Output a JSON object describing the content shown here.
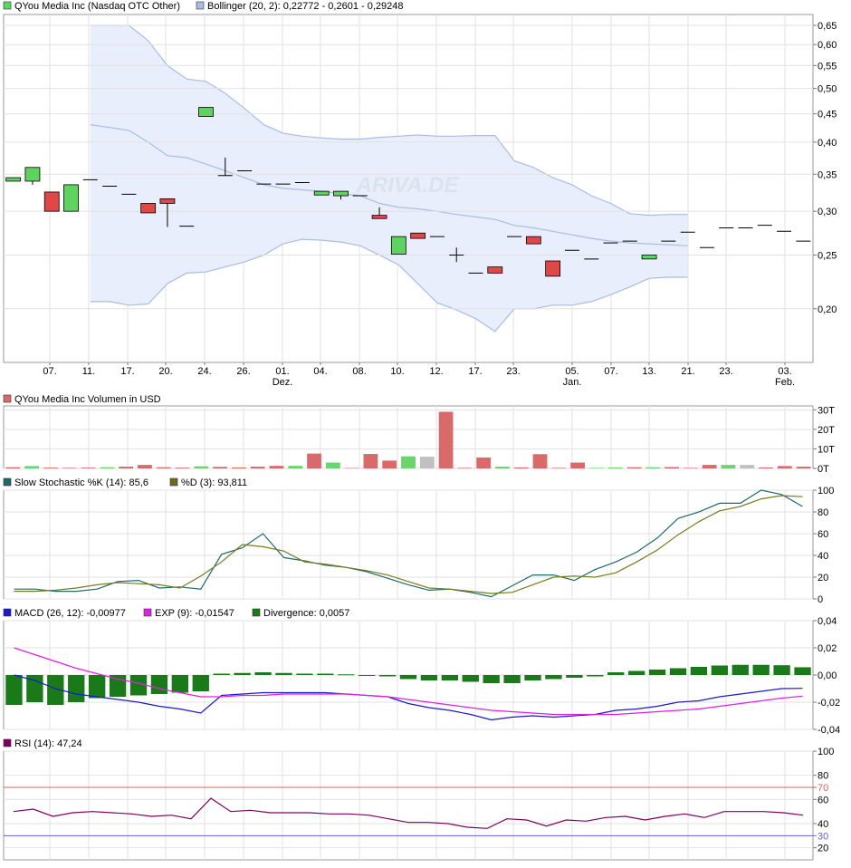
{
  "legends": {
    "price": {
      "label": "QYou Media Inc (Nasdaq OTC Other)",
      "color": "#5fd35f"
    },
    "bollinger": {
      "label": "Bollinger (20, 2): 0,22772 - 0,2601 - 0,29248",
      "color": "#a9bde3"
    },
    "volume": {
      "label": "QYou Media Inc Volumen in USD",
      "color": "#d86a6a"
    },
    "stoch_k": {
      "label": "Slow Stochastic %K (14): 85,6",
      "color": "#1f6b6b"
    },
    "stoch_d": {
      "label": "%D (3): 93,811",
      "color": "#6b6b1f"
    },
    "macd": {
      "label": "MACD (26, 12): -0,00977",
      "color": "#1a1acc"
    },
    "exp": {
      "label": "EXP (9): -0,01547",
      "color": "#e020e0"
    },
    "divergence": {
      "label": "Divergence: 0,0057",
      "color": "#1a7a1a"
    },
    "rsi": {
      "label": "RSI (14): 47,24",
      "color": "#800060"
    }
  },
  "watermark": "ARIVA.DE",
  "chart_data": [
    {
      "type": "candlestick",
      "name": "price",
      "x_ticks": [
        "07.",
        "11.",
        "17.",
        "20.",
        "24.",
        "26.",
        "01.",
        "04.",
        "08.",
        "10.",
        "12.",
        "17.",
        "23.",
        "05.",
        "07.",
        "13.",
        "21.",
        "23.",
        "03."
      ],
      "x_month_labels": [
        {
          "tick": "01.",
          "label": "Dez."
        },
        {
          "tick": "05.",
          "label": "Jan."
        },
        {
          "tick": "03.",
          "label": "Feb."
        }
      ],
      "y_ticks": [
        "0,65",
        "0,60",
        "0,55",
        "0,50",
        "0,45",
        "0,40",
        "0,35",
        "0,30",
        "0,25",
        "0,20"
      ],
      "y_scale": "log",
      "ylim": [
        0.16,
        0.68
      ],
      "candles": [
        {
          "o": 0.34,
          "h": 0.345,
          "l": 0.34,
          "c": 0.345
        },
        {
          "o": 0.34,
          "h": 0.36,
          "l": 0.335,
          "c": 0.36
        },
        {
          "o": 0.325,
          "h": 0.325,
          "l": 0.3,
          "c": 0.3
        },
        {
          "o": 0.3,
          "h": 0.335,
          "l": 0.3,
          "c": 0.335
        },
        {
          "o": 0.342,
          "h": 0.342,
          "l": 0.342,
          "c": 0.342
        },
        {
          "o": 0.333,
          "h": 0.333,
          "l": 0.333,
          "c": 0.333
        },
        {
          "o": 0.322,
          "h": 0.322,
          "l": 0.322,
          "c": 0.322
        },
        {
          "o": 0.31,
          "h": 0.31,
          "l": 0.298,
          "c": 0.298
        },
        {
          "o": 0.316,
          "h": 0.316,
          "l": 0.281,
          "c": 0.31
        },
        {
          "o": 0.282,
          "h": 0.282,
          "l": 0.282,
          "c": 0.282
        },
        {
          "o": 0.445,
          "h": 0.462,
          "l": 0.445,
          "c": 0.462
        },
        {
          "o": 0.348,
          "h": 0.375,
          "l": 0.348,
          "c": 0.348
        },
        {
          "o": 0.355,
          "h": 0.355,
          "l": 0.355,
          "c": 0.355
        },
        {
          "o": 0.336,
          "h": 0.336,
          "l": 0.336,
          "c": 0.336
        },
        {
          "o": 0.336,
          "h": 0.336,
          "l": 0.336,
          "c": 0.336
        },
        {
          "o": 0.338,
          "h": 0.338,
          "l": 0.338,
          "c": 0.338
        },
        {
          "o": 0.321,
          "h": 0.326,
          "l": 0.321,
          "c": 0.326
        },
        {
          "o": 0.32,
          "h": 0.326,
          "l": 0.315,
          "c": 0.326
        },
        {
          "o": 0.32,
          "h": 0.32,
          "l": 0.32,
          "c": 0.32
        },
        {
          "o": 0.295,
          "h": 0.305,
          "l": 0.291,
          "c": 0.291
        },
        {
          "o": 0.251,
          "h": 0.27,
          "l": 0.251,
          "c": 0.27
        },
        {
          "o": 0.274,
          "h": 0.274,
          "l": 0.268,
          "c": 0.268
        },
        {
          "o": 0.27,
          "h": 0.27,
          "l": 0.27,
          "c": 0.27
        },
        {
          "o": 0.25,
          "h": 0.258,
          "l": 0.243,
          "c": 0.25
        },
        {
          "o": 0.232,
          "h": 0.232,
          "l": 0.232,
          "c": 0.232
        },
        {
          "o": 0.238,
          "h": 0.238,
          "l": 0.232,
          "c": 0.232
        },
        {
          "o": 0.27,
          "h": 0.27,
          "l": 0.27,
          "c": 0.27
        },
        {
          "o": 0.27,
          "h": 0.27,
          "l": 0.262,
          "c": 0.262
        },
        {
          "o": 0.244,
          "h": 0.244,
          "l": 0.229,
          "c": 0.229
        },
        {
          "o": 0.255,
          "h": 0.255,
          "l": 0.255,
          "c": 0.255
        },
        {
          "o": 0.246,
          "h": 0.246,
          "l": 0.246,
          "c": 0.246
        },
        {
          "o": 0.263,
          "h": 0.263,
          "l": 0.263,
          "c": 0.263
        },
        {
          "o": 0.265,
          "h": 0.265,
          "l": 0.265,
          "c": 0.265
        },
        {
          "o": 0.246,
          "h": 0.25,
          "l": 0.246,
          "c": 0.25
        },
        {
          "o": 0.265,
          "h": 0.265,
          "l": 0.265,
          "c": 0.265
        },
        {
          "o": 0.275,
          "h": 0.275,
          "l": 0.275,
          "c": 0.275
        },
        {
          "o": 0.258,
          "h": 0.258,
          "l": 0.258,
          "c": 0.258
        },
        {
          "o": 0.28,
          "h": 0.28,
          "l": 0.28,
          "c": 0.28
        },
        {
          "o": 0.28,
          "h": 0.28,
          "l": 0.28,
          "c": 0.28
        },
        {
          "o": 0.283,
          "h": 0.283,
          "l": 0.283,
          "c": 0.283
        },
        {
          "o": 0.276,
          "h": 0.276,
          "l": 0.276,
          "c": 0.276
        },
        {
          "o": 0.265,
          "h": 0.265,
          "l": 0.265,
          "c": 0.265
        }
      ],
      "bollinger": {
        "start_index": 4,
        "upper": [
          0.65,
          0.65,
          0.65,
          0.61,
          0.55,
          0.52,
          0.515,
          0.49,
          0.46,
          0.43,
          0.415,
          0.41,
          0.407,
          0.405,
          0.405,
          0.408,
          0.41,
          0.412,
          0.41,
          0.41,
          0.411,
          0.411,
          0.37,
          0.36,
          0.345,
          0.335,
          0.32,
          0.31,
          0.297,
          0.295,
          0.296,
          0.296
        ],
        "middle": [
          0.43,
          0.425,
          0.42,
          0.4,
          0.378,
          0.375,
          0.365,
          0.355,
          0.345,
          0.335,
          0.33,
          0.328,
          0.326,
          0.323,
          0.32,
          0.31,
          0.305,
          0.303,
          0.3,
          0.296,
          0.293,
          0.29,
          0.283,
          0.28,
          0.276,
          0.272,
          0.268,
          0.265,
          0.263,
          0.262,
          0.261,
          0.26
        ],
        "lower": [
          0.206,
          0.206,
          0.203,
          0.204,
          0.222,
          0.232,
          0.233,
          0.238,
          0.243,
          0.25,
          0.262,
          0.267,
          0.266,
          0.264,
          0.26,
          0.25,
          0.24,
          0.222,
          0.205,
          0.199,
          0.192,
          0.182,
          0.2,
          0.2,
          0.203,
          0.203,
          0.206,
          0.212,
          0.219,
          0.227,
          0.228,
          0.228
        ]
      }
    },
    {
      "type": "bar",
      "name": "volume",
      "y_ticks": [
        "30T",
        "20T",
        "10T",
        "0T"
      ],
      "ylim": [
        0,
        32
      ],
      "values": [
        0.6,
        1.2,
        0.4,
        0.3,
        0.4,
        0.6,
        0.9,
        1.8,
        0.6,
        0.4,
        1.1,
        0.8,
        0.5,
        0.9,
        1.3,
        1.3,
        7.6,
        3.0,
        0.2,
        7.4,
        4.0,
        6.2,
        6.0,
        29.0,
        0.3,
        5.6,
        0.9,
        0.5,
        7.3,
        0.3,
        3.0,
        0.3,
        0.5,
        0.6,
        0.6,
        0.7,
        0.3,
        1.8,
        1.8,
        1.8,
        0.5,
        1.2,
        0.9
      ],
      "colors": [
        "red",
        "green",
        "red",
        "red",
        "red",
        "green",
        "red",
        "red",
        "red",
        "red",
        "green",
        "red",
        "red",
        "red",
        "red",
        "green",
        "red",
        "green",
        "red",
        "red",
        "red",
        "green",
        "grey",
        "red",
        "red",
        "red",
        "green",
        "red",
        "red",
        "red",
        "red",
        "green",
        "green",
        "red",
        "green",
        "red",
        "red",
        "red",
        "green",
        "grey",
        "red",
        "red",
        "red"
      ]
    },
    {
      "type": "line",
      "name": "slow_stochastic",
      "y_ticks": [
        "100",
        "80",
        "60",
        "40",
        "20",
        "0"
      ],
      "ylim": [
        0,
        100
      ],
      "series": [
        {
          "name": "%K",
          "values": [
            9,
            9,
            7,
            7,
            9,
            16,
            17,
            10,
            11,
            9,
            41,
            47,
            60,
            38,
            35,
            31,
            29,
            25,
            19,
            13,
            8,
            9,
            6,
            2,
            12,
            22,
            22,
            17,
            27,
            34,
            43,
            56,
            74,
            80,
            88,
            88,
            100,
            96,
            85
          ]
        },
        {
          "name": "%D",
          "values": [
            7,
            7,
            8,
            10,
            13,
            15,
            14,
            13,
            10,
            21,
            34,
            50,
            48,
            44,
            34,
            32,
            29,
            26,
            22,
            16,
            10,
            9,
            7,
            5,
            6,
            13,
            20,
            21,
            20,
            24,
            34,
            45,
            59,
            71,
            81,
            85,
            92,
            95,
            94
          ]
        }
      ]
    },
    {
      "type": "line+bar",
      "name": "macd",
      "y_ticks": [
        "0,04",
        "0,02",
        "0,00",
        "-0,02",
        "-0,04"
      ],
      "ylim": [
        -0.04,
        0.04
      ],
      "series": [
        {
          "name": "MACD",
          "values": [
            0.0,
            -0.004,
            -0.01,
            -0.014,
            -0.016,
            -0.018,
            -0.02,
            -0.023,
            -0.025,
            -0.028,
            -0.015,
            -0.014,
            -0.013,
            -0.013,
            -0.013,
            -0.013,
            -0.014,
            -0.015,
            -0.016,
            -0.021,
            -0.024,
            -0.026,
            -0.029,
            -0.033,
            -0.031,
            -0.03,
            -0.031,
            -0.03,
            -0.029,
            -0.026,
            -0.025,
            -0.023,
            -0.02,
            -0.019,
            -0.016,
            -0.014,
            -0.012,
            -0.01,
            -0.0098
          ]
        },
        {
          "name": "EXP",
          "values": [
            0.02,
            0.015,
            0.01,
            0.005,
            0.001,
            -0.003,
            -0.006,
            -0.01,
            -0.013,
            -0.016,
            -0.016,
            -0.015,
            -0.015,
            -0.014,
            -0.014,
            -0.014,
            -0.014,
            -0.015,
            -0.016,
            -0.018,
            -0.02,
            -0.022,
            -0.024,
            -0.026,
            -0.027,
            -0.028,
            -0.029,
            -0.029,
            -0.029,
            -0.029,
            -0.028,
            -0.027,
            -0.026,
            -0.025,
            -0.023,
            -0.021,
            -0.019,
            -0.017,
            -0.0155
          ]
        },
        {
          "name": "Divergence",
          "values": [
            -0.022,
            -0.02,
            -0.022,
            -0.02,
            -0.017,
            -0.016,
            -0.015,
            -0.014,
            -0.013,
            -0.012,
            0.001,
            0.0015,
            0.002,
            0.0015,
            0.001,
            0.001,
            0.0005,
            -0.0005,
            -0.001,
            -0.003,
            -0.004,
            -0.004,
            -0.005,
            -0.006,
            -0.006,
            -0.004,
            -0.003,
            -0.002,
            -0.001,
            0.002,
            0.003,
            0.004,
            0.005,
            0.006,
            0.007,
            0.0075,
            0.0075,
            0.0072,
            0.0057
          ]
        }
      ]
    },
    {
      "type": "line",
      "name": "rsi",
      "y_ticks": [
        "100",
        "80",
        "70",
        "60",
        "40",
        "30",
        "20"
      ],
      "ylim": [
        10,
        100
      ],
      "reference_lines": [
        {
          "value": 70,
          "label": "70",
          "color": "#e06060"
        },
        {
          "value": 30,
          "label": "30",
          "color": "#6060e0"
        }
      ],
      "values": [
        50,
        52,
        46,
        49,
        50,
        49,
        48,
        46,
        47,
        44,
        61,
        50,
        51,
        49,
        49,
        49,
        48,
        48,
        47,
        44,
        41,
        41,
        40,
        37,
        36,
        44,
        43,
        38,
        43,
        42,
        45,
        46,
        43,
        46,
        48,
        45,
        50,
        50,
        50,
        49,
        47
      ]
    }
  ]
}
